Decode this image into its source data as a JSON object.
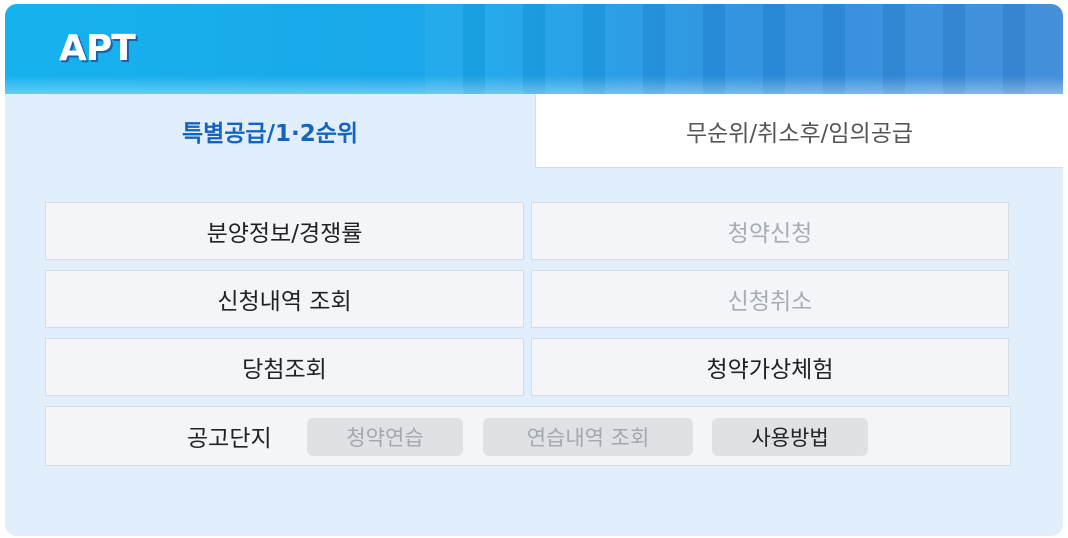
{
  "header": {
    "title": "APT"
  },
  "tabs": [
    {
      "label": "특별공급/1·2순위",
      "active": true
    },
    {
      "label": "무순위/취소후/임의공급",
      "active": false
    }
  ],
  "menu": {
    "sale_info": "분양정보/경쟁률",
    "apply": "청약신청",
    "history": "신청내역 조회",
    "cancel": "신청취소",
    "winner": "당첨조회",
    "virtual": "청약가상체험"
  },
  "notice": {
    "label": "공고단지",
    "practice": "청약연습",
    "practice_history": "연습내역 조회",
    "howto": "사용방법"
  },
  "colors": {
    "accent": "#1565c0",
    "header": "#1aa6ea",
    "panel": "#e1effd"
  }
}
